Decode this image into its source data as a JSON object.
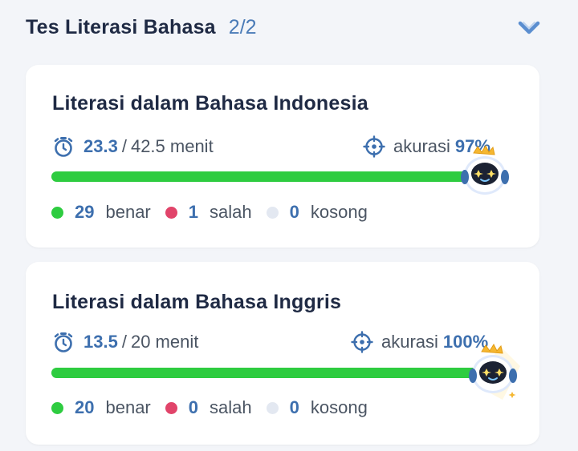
{
  "header": {
    "title": "Tes Literasi Bahasa",
    "count": "2/2"
  },
  "colors": {
    "accent": "#3d6fae",
    "progress": "#2ecc40",
    "correct": "#2ecc40",
    "wrong": "#e1446a",
    "empty": "#e3e8f1"
  },
  "cards": [
    {
      "title": "Literasi dalam Bahasa Indonesia",
      "time_used": "23.3",
      "separator": "/",
      "time_total": "42.5 menit",
      "accuracy_label": "akurasi",
      "accuracy_value": "97%",
      "progress": 0.97,
      "correct_count": "29",
      "correct_label": "benar",
      "wrong_count": "1",
      "wrong_label": "salah",
      "empty_count": "0",
      "empty_label": "kosong"
    },
    {
      "title": "Literasi dalam Bahasa Inggris",
      "time_used": "13.5",
      "separator": "/",
      "time_total": "20 menit",
      "accuracy_label": "akurasi",
      "accuracy_value": "100%",
      "progress": 1.0,
      "correct_count": "20",
      "correct_label": "benar",
      "wrong_count": "0",
      "wrong_label": "salah",
      "empty_count": "0",
      "empty_label": "kosong"
    }
  ],
  "icons": [
    "stopwatch-icon",
    "target-icon",
    "chevron-down-icon",
    "mascot-icon"
  ]
}
